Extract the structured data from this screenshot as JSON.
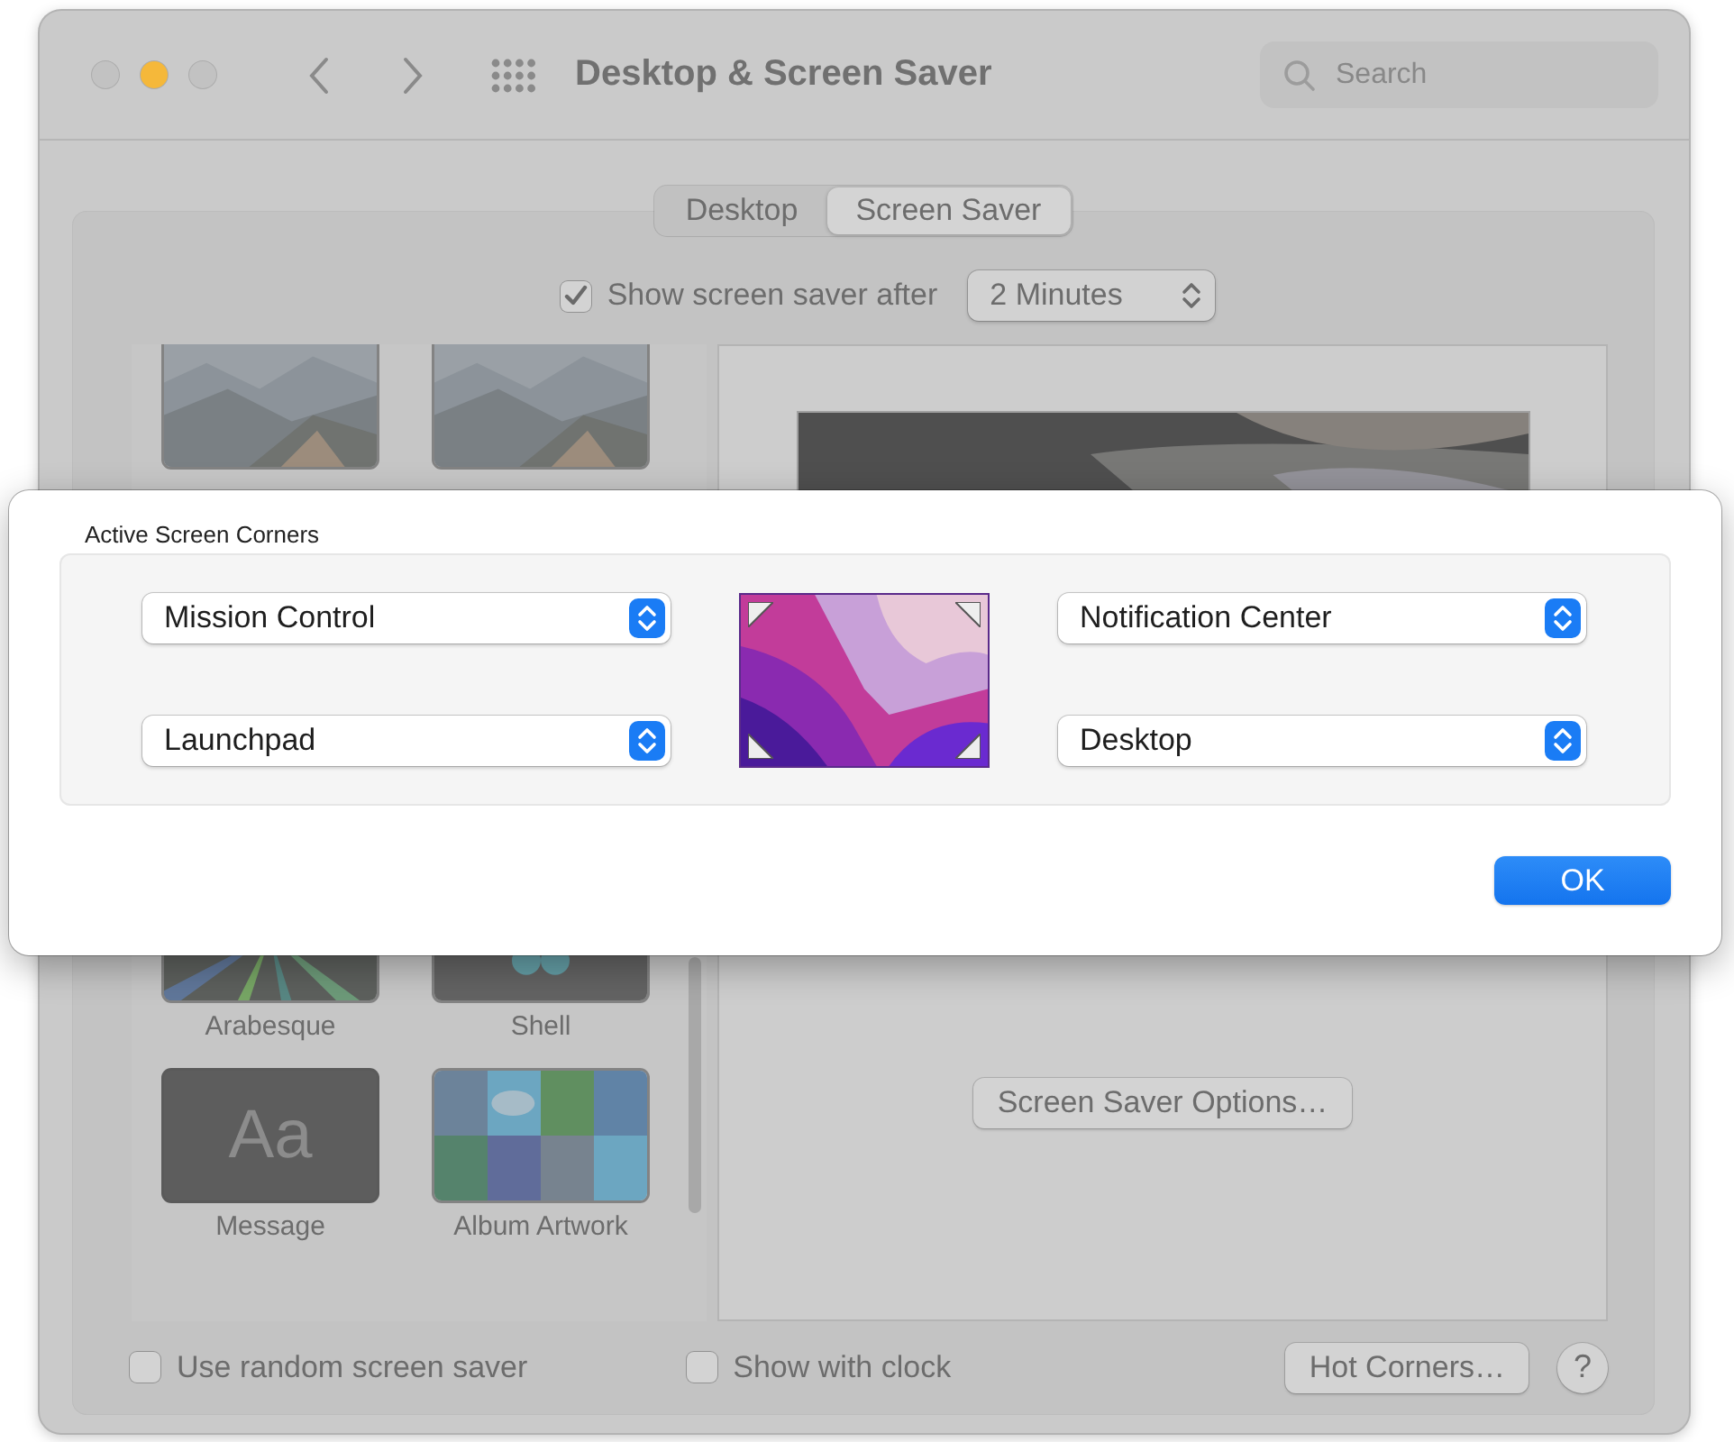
{
  "window": {
    "title": "Desktop & Screen Saver",
    "search": {
      "placeholder": "Search"
    }
  },
  "tabs": [
    {
      "label": "Desktop",
      "selected": false
    },
    {
      "label": "Screen Saver",
      "selected": true
    }
  ],
  "show_after": {
    "label": "Show screen saver after",
    "checked": true,
    "value": "2 Minutes"
  },
  "savers": [
    {
      "kind": "mountains"
    },
    {
      "kind": "mountains"
    },
    {
      "name": "Arabesque",
      "kind": "rays"
    },
    {
      "name": "Shell",
      "kind": "flower"
    },
    {
      "name": "Message",
      "kind": "text",
      "preview_text": "Aa"
    },
    {
      "name": "Album Artwork",
      "kind": "tiles"
    }
  ],
  "preview": {
    "options_button": "Screen Saver Options…"
  },
  "random": {
    "label": "Use random screen saver",
    "checked": false
  },
  "clock": {
    "label": "Show with clock",
    "checked": false
  },
  "hot_corners_button": "Hot Corners…",
  "help_button": "?",
  "sheet": {
    "title": "Active Screen Corners",
    "corners": [
      {
        "value": "Mission Control"
      },
      {
        "value": "Notification Center"
      },
      {
        "value": "Launchpad"
      },
      {
        "value": "Desktop"
      }
    ],
    "ok_button": "OK"
  }
}
